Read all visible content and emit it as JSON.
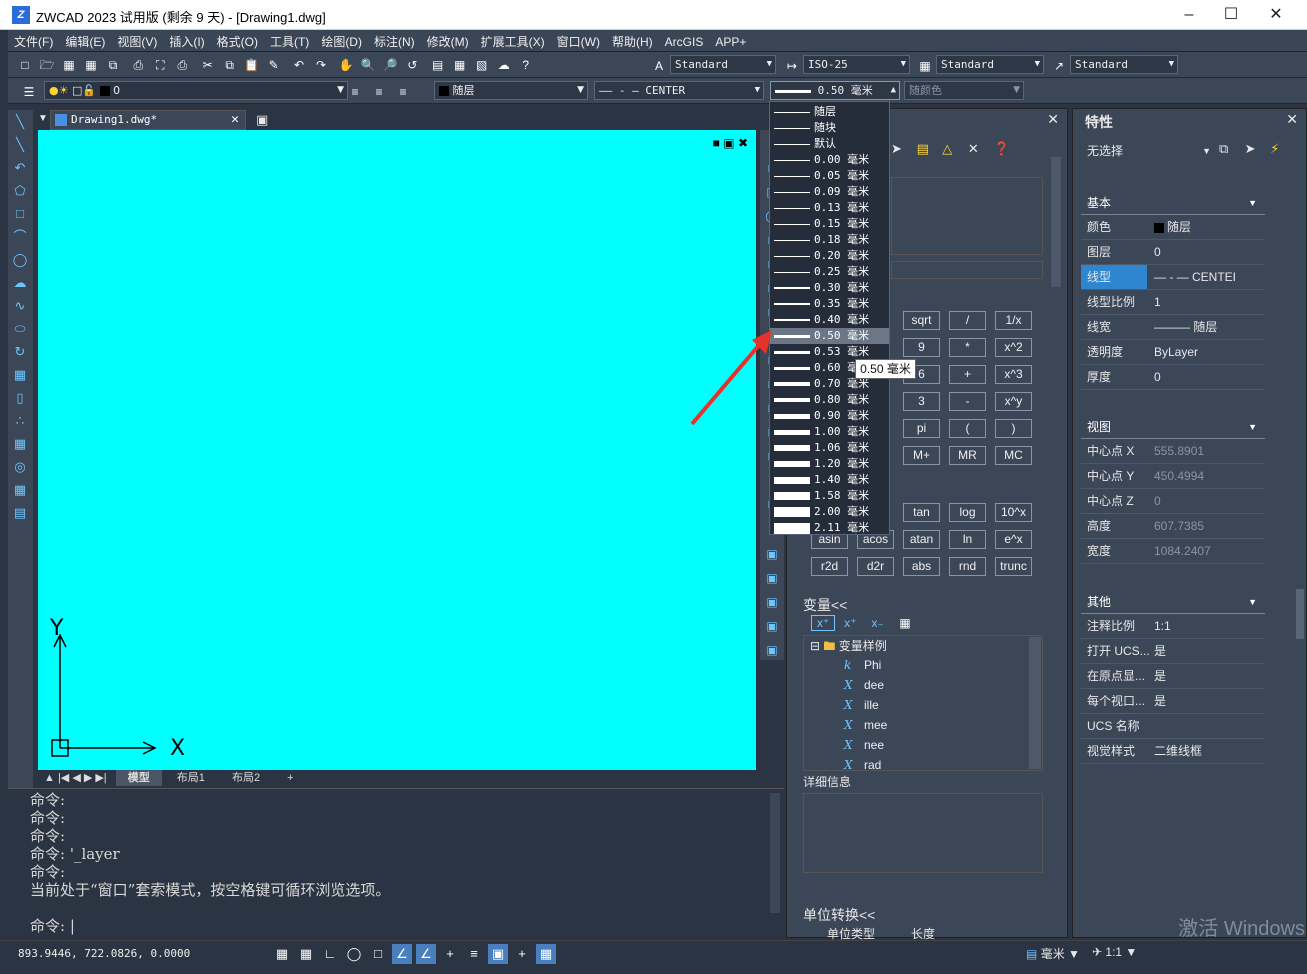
{
  "title": "ZWCAD 2023 试用版 (剩余 9 天) - [Drawing1.dwg]",
  "logo": "Z",
  "menu": [
    "文件(F)",
    "编辑(E)",
    "视图(V)",
    "插入(I)",
    "格式(O)",
    "工具(T)",
    "绘图(D)",
    "标注(N)",
    "修改(M)",
    "扩展工具(X)",
    "窗口(W)",
    "帮助(H)",
    "ArcGIS",
    "APP+"
  ],
  "toolbar": {
    "textstyle": "Standard",
    "dimstyle": "ISO-25",
    "tablestyle": "Standard",
    "mleaderstyle": "Standard",
    "layer": "0",
    "color": "随层",
    "linetype": "CENTER",
    "lineweight": "0.50 毫米",
    "plotstyle": "随颜色"
  },
  "doc_tab": "Drawing1.dwg*",
  "layout_tabs": [
    "模型",
    "布局1",
    "布局2",
    "+"
  ],
  "ucs": {
    "y": "Y",
    "x": "X"
  },
  "command_lines": [
    "命令:",
    "命令:",
    "命令:",
    "命令: '_layer",
    "命令:",
    "当前处于“窗口”套索模式，按空格键可循环浏览选项。"
  ],
  "command_prompt": "命令:",
  "coords": "893.9446, 722.0826, 0.0000",
  "lineweight_options": [
    {
      "label": "随层",
      "w": 1
    },
    {
      "label": "随块",
      "w": 1
    },
    {
      "label": "默认",
      "w": 1
    },
    {
      "label": "0.00 毫米",
      "w": 1
    },
    {
      "label": "0.05 毫米",
      "w": 1
    },
    {
      "label": "0.09 毫米",
      "w": 1
    },
    {
      "label": "0.13 毫米",
      "w": 1
    },
    {
      "label": "0.15 毫米",
      "w": 1
    },
    {
      "label": "0.18 毫米",
      "w": 1
    },
    {
      "label": "0.20 毫米",
      "w": 1
    },
    {
      "label": "0.25 毫米",
      "w": 1
    },
    {
      "label": "0.30 毫米",
      "w": 2
    },
    {
      "label": "0.35 毫米",
      "w": 2
    },
    {
      "label": "0.40 毫米",
      "w": 2
    },
    {
      "label": "0.50 毫米",
      "w": 3
    },
    {
      "label": "0.53 毫米",
      "w": 3
    },
    {
      "label": "0.60 毫米",
      "w": 3
    },
    {
      "label": "0.70 毫米",
      "w": 4
    },
    {
      "label": "0.80 毫米",
      "w": 4
    },
    {
      "label": "0.90 毫米",
      "w": 5
    },
    {
      "label": "1.00 毫米",
      "w": 5
    },
    {
      "label": "1.06 毫米",
      "w": 6
    },
    {
      "label": "1.20 毫米",
      "w": 6
    },
    {
      "label": "1.40 毫米",
      "w": 7
    },
    {
      "label": "1.58 毫米",
      "w": 8
    },
    {
      "label": "2.00 毫米",
      "w": 10
    },
    {
      "label": "2.11 毫米",
      "w": 11
    }
  ],
  "selected_lineweight": "0.50 毫米",
  "tooltip": "0.50 毫米",
  "calc": {
    "buttons1": [
      [
        "sqrt",
        "/",
        "1/x"
      ],
      [
        "9",
        "*",
        "x^2"
      ],
      [
        "6",
        "+",
        "x^3"
      ],
      [
        "3",
        "-",
        "x^y"
      ],
      [
        "pi",
        "(",
        ")"
      ],
      [
        "M+",
        "MR",
        "MC"
      ]
    ],
    "buttons2": [
      [
        "tan",
        "log",
        "10^x"
      ],
      [
        "asin",
        "acos",
        "atan",
        "ln",
        "e^x"
      ],
      [
        "r2d",
        "d2r",
        "abs",
        "rnd",
        "trunc"
      ]
    ],
    "vars_title": "变量<<",
    "vars_root": "变量样例",
    "vars": [
      {
        "icon": "k",
        "name": "Phi"
      },
      {
        "icon": "X",
        "name": "dee"
      },
      {
        "icon": "X",
        "name": "ille"
      },
      {
        "icon": "X",
        "name": "mee"
      },
      {
        "icon": "X",
        "name": "nee"
      },
      {
        "icon": "X",
        "name": "rad"
      }
    ],
    "details": "详细信息",
    "unit_title": "单位转换<<",
    "unit_type": "单位类型",
    "unit_val": "长度"
  },
  "props": {
    "title": "特性",
    "selection": "无选择",
    "sections": {
      "basic": "基本",
      "view": "视图",
      "other": "其他"
    },
    "basic": [
      [
        "颜色",
        "随层"
      ],
      [
        "图层",
        "0"
      ],
      [
        "线型",
        "— - — CENTEI"
      ],
      [
        "线型比例",
        "1"
      ],
      [
        "线宽",
        "——— 随层"
      ],
      [
        "透明度",
        "ByLayer"
      ],
      [
        "厚度",
        "0"
      ]
    ],
    "view": [
      [
        "中心点 X",
        "555.8901"
      ],
      [
        "中心点 Y",
        "450.4994"
      ],
      [
        "中心点 Z",
        "0"
      ],
      [
        "高度",
        "607.7385"
      ],
      [
        "宽度",
        "1084.2407"
      ]
    ],
    "other": [
      [
        "注释比例",
        "1:1"
      ],
      [
        "打开 UCS...",
        "是"
      ],
      [
        "在原点显...",
        "是"
      ],
      [
        "每个视口...",
        "是"
      ],
      [
        "UCS 名称",
        ""
      ],
      [
        "视觉样式",
        "二维线框"
      ]
    ]
  },
  "status_right": {
    "unit": "毫米",
    "scale": "1:1"
  },
  "watermark": "激活 Windows"
}
